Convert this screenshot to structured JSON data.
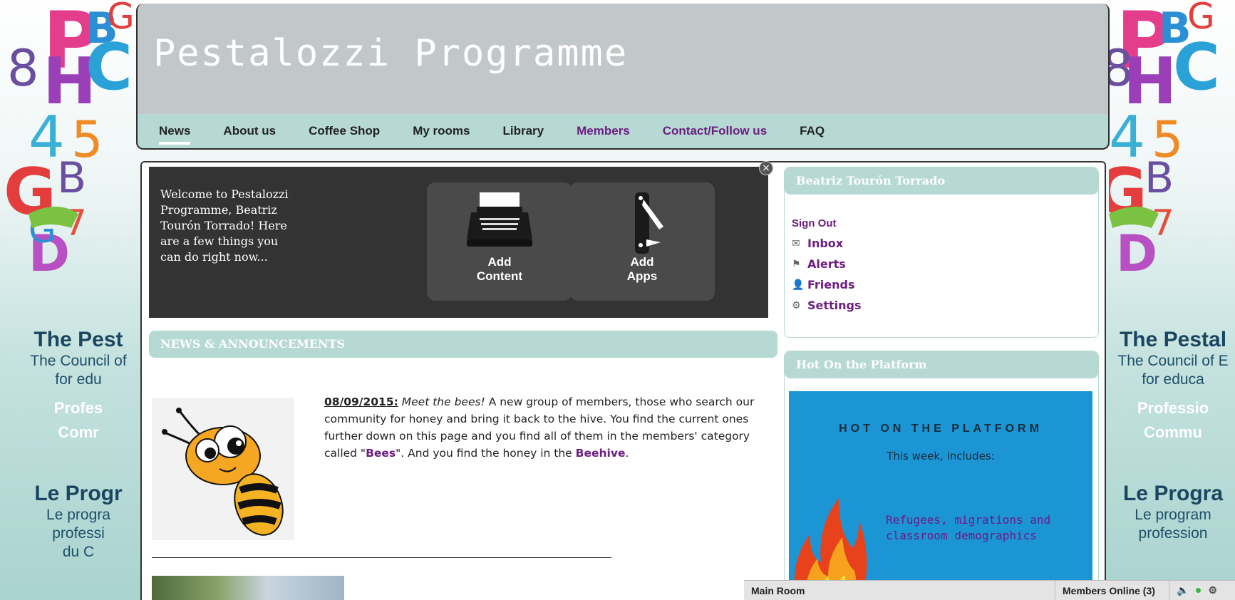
{
  "site": {
    "title": "Pestalozzi Programme"
  },
  "nav": [
    {
      "label": "News",
      "active": true
    },
    {
      "label": "About us"
    },
    {
      "label": "Coffee Shop"
    },
    {
      "label": "My rooms"
    },
    {
      "label": "Library"
    },
    {
      "label": "Members"
    },
    {
      "label": "Contact/Follow us"
    },
    {
      "label": "FAQ"
    }
  ],
  "side": {
    "left": {
      "h1": "The Pest",
      "p1": "The Council of",
      "p2": "for edu",
      "pro": "Profes",
      "com": "Comr",
      "h2": "Le Progr",
      "p3": "Le progra",
      "p4": "professi",
      "p5": "du C"
    },
    "right": {
      "h1": "The Pestal",
      "p1": "The Council of E",
      "p2": "for educa",
      "pro": "Professio",
      "com": "Commu",
      "h2": "Le Progra",
      "p3": "Le program",
      "p4": "profession"
    }
  },
  "welcome": {
    "text": "Welcome to Pestalozzi Programme, Beatriz Tourón Torrado! Here are a few things you can do right now...",
    "add_content": "Add\nContent",
    "add_apps": "Add\nApps",
    "close": "×"
  },
  "news": {
    "header": "NEWS & ANNOUNCEMENTS",
    "date": "08/09/2015:",
    "headline": "Meet the bees!",
    "body_1": " A new group of members, those who search our community for honey and bring it back to the hive. You find the current ones further down on this page and you find all of them in the members' category called \"",
    "bees_link": "Bees",
    "body_2": "\". And you find the honey in the ",
    "beehive_link": "Beehive",
    "body_3": "."
  },
  "profile": {
    "name": "Beatriz Tourón Torrado",
    "sign_out": "Sign Out",
    "inbox": "Inbox",
    "alerts": "Alerts",
    "friends": "Friends",
    "settings": "Settings"
  },
  "hot": {
    "header": "Hot On the Platform",
    "title": "HOT ON THE PLATFORM",
    "subtitle": "This week, includes:",
    "topic": "Refugees, migrations and classroom demographics"
  },
  "chat": {
    "room": "Main Room",
    "online": "Members Online (3)"
  },
  "colors": {
    "nav_bg": "#b6d9d4",
    "header_bg": "#c2c8c9",
    "accent_purple": "#6d1f80",
    "hot_blue": "#1c95d5"
  }
}
